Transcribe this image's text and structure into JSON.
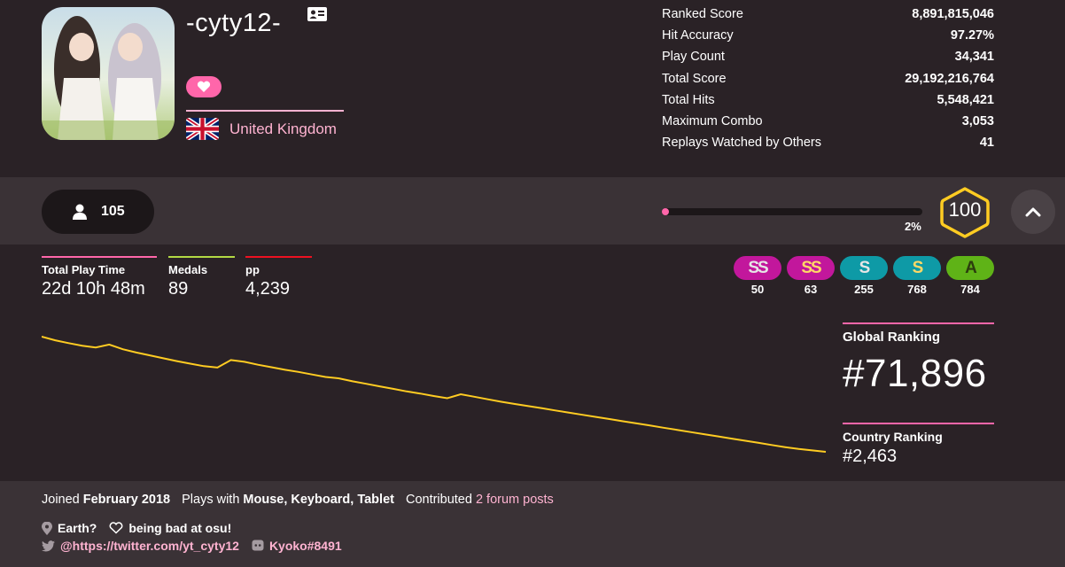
{
  "profile": {
    "username": "-cyty12-",
    "country": "United Kingdom"
  },
  "stats": [
    {
      "label": "Ranked Score",
      "value": "8,891,815,046"
    },
    {
      "label": "Hit Accuracy",
      "value": "97.27%"
    },
    {
      "label": "Play Count",
      "value": "34,341"
    },
    {
      "label": "Total Score",
      "value": "29,192,216,764"
    },
    {
      "label": "Total Hits",
      "value": "5,548,421"
    },
    {
      "label": "Maximum Combo",
      "value": "3,053"
    },
    {
      "label": "Replays Watched by Others",
      "value": "41"
    }
  ],
  "followers": "105",
  "level": {
    "number": "100",
    "progress_text": "2%",
    "progress": 0.02
  },
  "ministats": [
    {
      "label": "Total Play Time",
      "value": "22d 10h 48m",
      "color": "#ff66aa"
    },
    {
      "label": "Medals",
      "value": "89",
      "color": "#b3d944"
    },
    {
      "label": "pp",
      "value": "4,239",
      "color": "#ed1121"
    }
  ],
  "grades": [
    {
      "grade": "SS",
      "count": "50",
      "bg": "#c2179c",
      "fg": "#e6e6e6"
    },
    {
      "grade": "SS",
      "count": "63",
      "bg": "#c2179c",
      "fg": "#ffd966"
    },
    {
      "grade": "S",
      "count": "255",
      "bg": "#0e9aa6",
      "fg": "#e6e6e6"
    },
    {
      "grade": "S",
      "count": "768",
      "bg": "#0e9aa6",
      "fg": "#ffd966"
    },
    {
      "grade": "A",
      "count": "784",
      "bg": "#5fb317",
      "fg": "#2c3d0e"
    }
  ],
  "rank_history": [
    120000,
    119000,
    118200,
    117500,
    117000,
    117800,
    116500,
    115600,
    114800,
    114000,
    113200,
    112500,
    111800,
    111400,
    113500,
    113000,
    112200,
    111500,
    110800,
    110200,
    109500,
    108800,
    108400,
    107600,
    106900,
    106200,
    105500,
    104800,
    104200,
    103500,
    102900,
    104000,
    103300,
    102600,
    101900,
    101300,
    100700,
    100100,
    99500,
    98900,
    98300,
    97700,
    97100,
    96500,
    95900,
    95300,
    94700,
    94100,
    93500,
    92900,
    92300,
    91700,
    91100,
    90500,
    89900,
    89300,
    88800,
    88400,
    88000
  ],
  "ranking": {
    "global_label": "Global Ranking",
    "global_value": "#71,896",
    "country_label": "Country Ranking",
    "country_value": "#2,463"
  },
  "footer": {
    "joined_prefix": "Joined",
    "joined_value": "February 2018",
    "plays_prefix": "Plays with",
    "plays_value": "Mouse, Keyboard, Tablet",
    "contrib_prefix": "Contributed",
    "contrib_link": "2 forum posts",
    "location": "Earth?",
    "interests": "being bad at osu!",
    "twitter": "@https://twitter.com/yt_cyty12",
    "discord": "Kyoko#8491"
  },
  "colors": {
    "accent": "#ff66aa",
    "chart_line": "#ffcc22",
    "level_ring": "#ffcc22"
  }
}
